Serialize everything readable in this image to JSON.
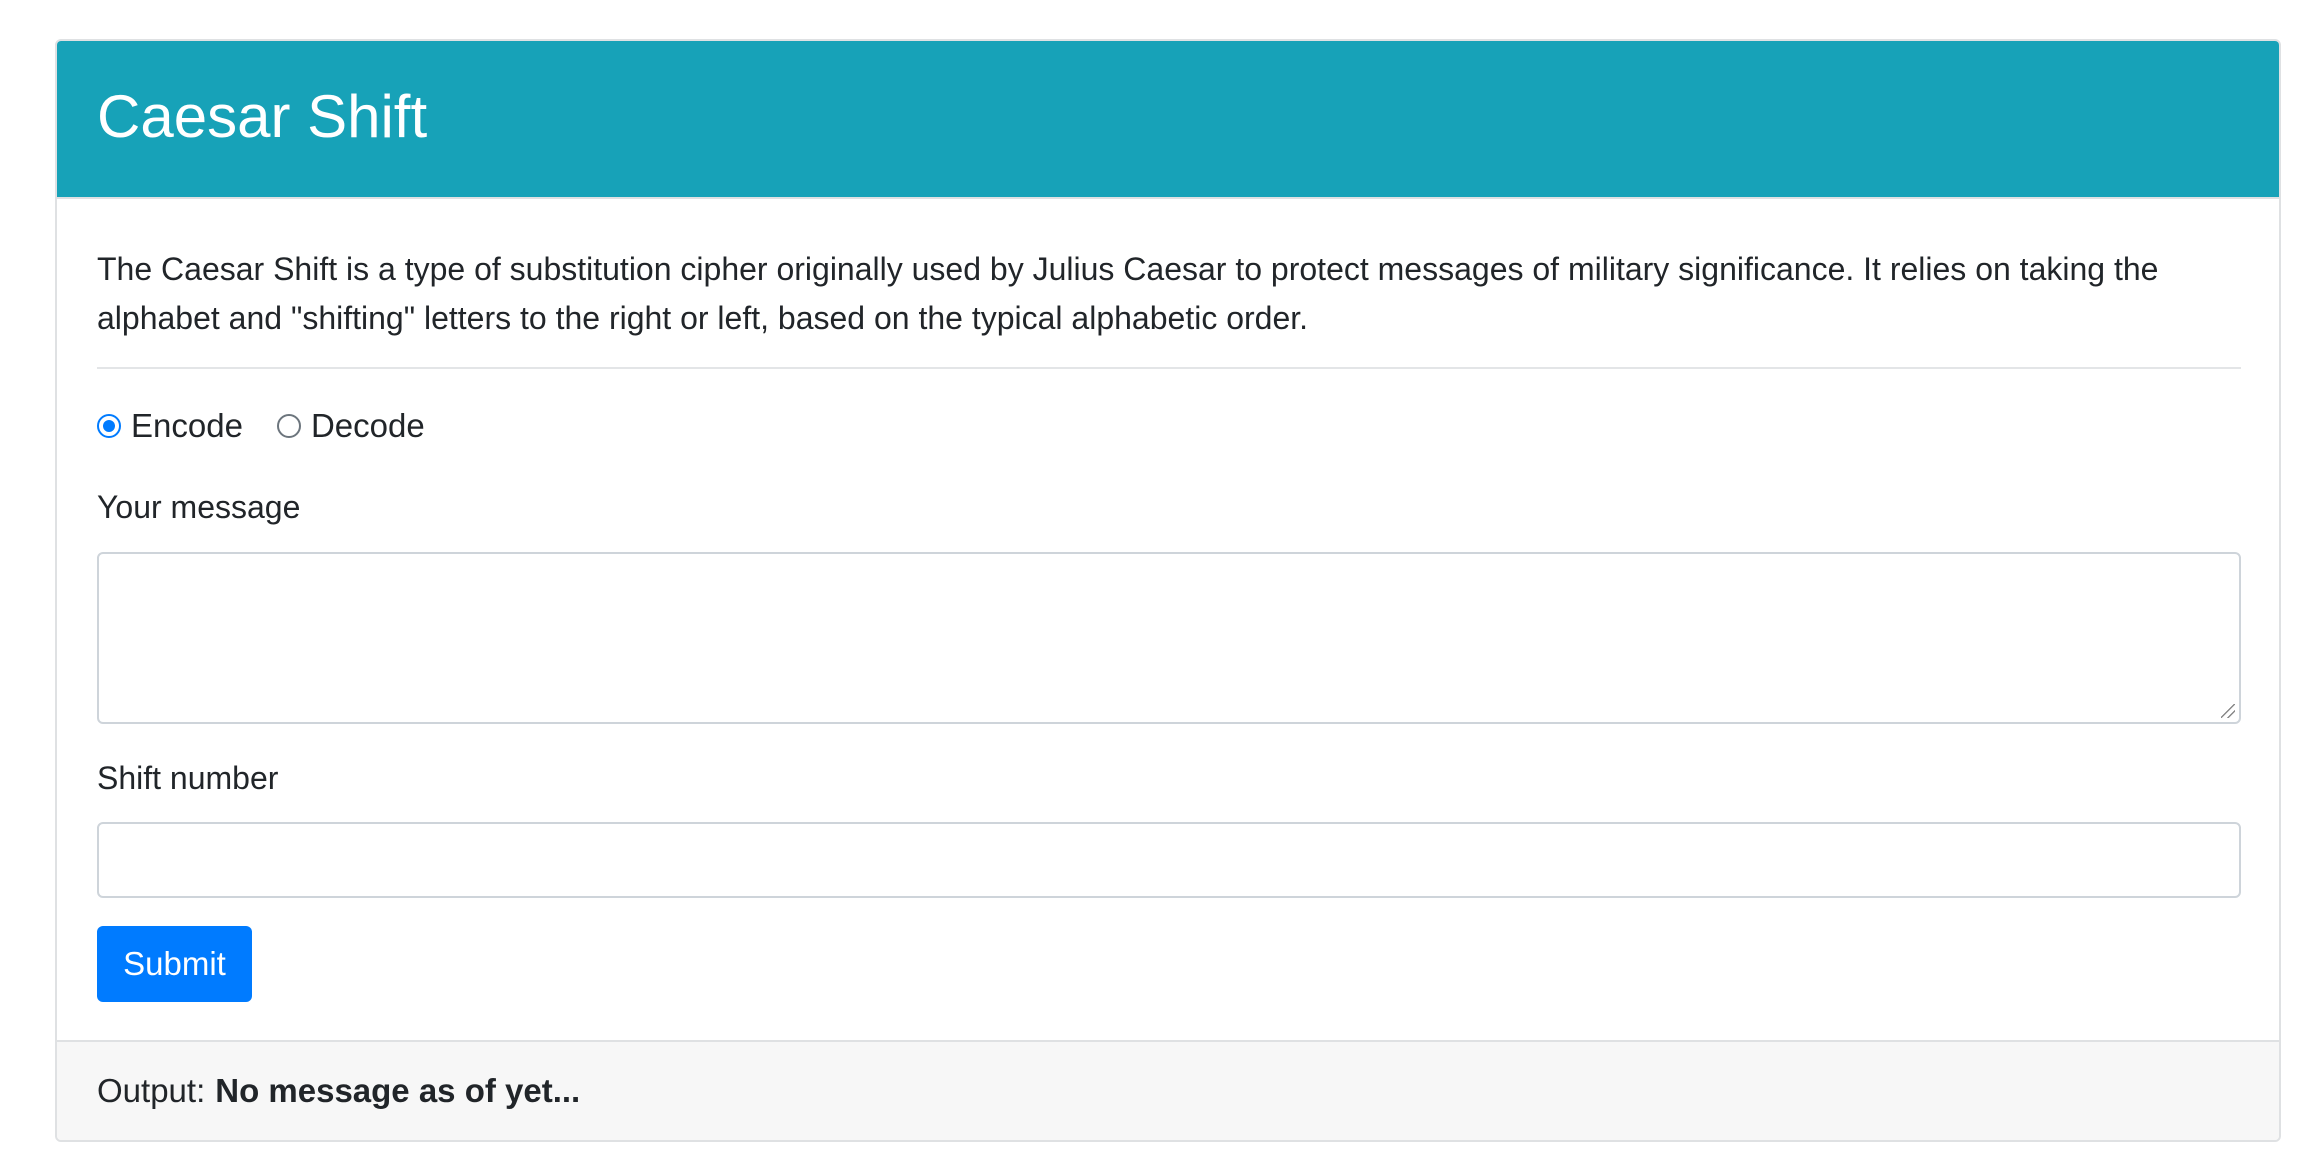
{
  "header": {
    "title": "Caesar Shift"
  },
  "intro": "The Caesar Shift is a type of substitution cipher originally used by Julius Caesar to protect messages of military significance. It relies on taking the alphabet and \"shifting\" letters to the right or left, based on the typical alphabetic order.",
  "mode": {
    "options": [
      {
        "label": "Encode",
        "checked": true
      },
      {
        "label": "Decode",
        "checked": false
      }
    ]
  },
  "message": {
    "label": "Your message",
    "value": "",
    "placeholder": ""
  },
  "shift": {
    "label": "Shift number",
    "value": "",
    "placeholder": ""
  },
  "submit": {
    "label": "Submit"
  },
  "output": {
    "label": "Output:",
    "value": "No message as of yet..."
  },
  "colors": {
    "header_bg": "#17a2b8",
    "primary": "#007bff",
    "footer_bg": "#f7f7f7"
  }
}
